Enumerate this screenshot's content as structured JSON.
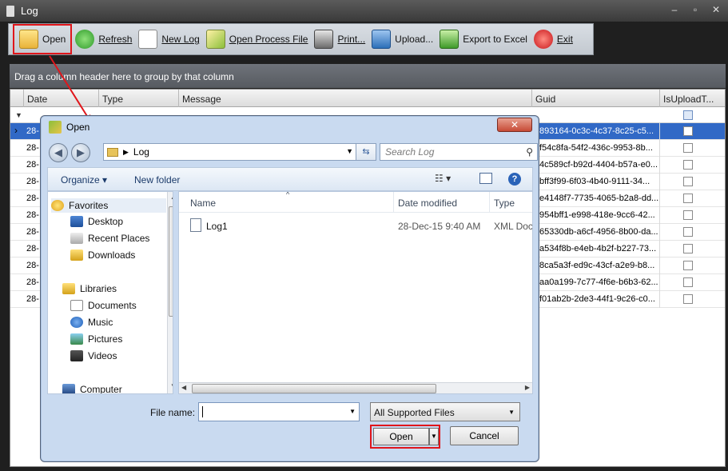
{
  "window": {
    "title": "Log",
    "minimize": "–",
    "maximize": "▫",
    "close": "✕"
  },
  "toolbar": {
    "items": [
      {
        "label": "Open"
      },
      {
        "label": "Refresh"
      },
      {
        "label": "New Log"
      },
      {
        "label": "Open Process File"
      },
      {
        "label": "Print..."
      },
      {
        "label": "Upload..."
      },
      {
        "label": "Export to Excel"
      },
      {
        "label": "Exit"
      }
    ]
  },
  "grid": {
    "group_hint": "Drag a column header here to group by that column",
    "columns": [
      "Date",
      "Type",
      "Message",
      "Guid",
      "IsUploadT..."
    ],
    "rows": [
      {
        "date": "28-",
        "guid": "893164-0c3c-4c37-8c25-c5..."
      },
      {
        "date": "28-",
        "guid": "f54c8fa-54f2-436c-9953-8b..."
      },
      {
        "date": "28-",
        "guid": "4c589cf-b92d-4404-b57a-e0..."
      },
      {
        "date": "28-",
        "guid": "bff3f99-6f03-4b40-9111-34..."
      },
      {
        "date": "28-",
        "guid": "e4148f7-7735-4065-b2a8-dd..."
      },
      {
        "date": "28-",
        "guid": "954bff1-e998-418e-9cc6-42..."
      },
      {
        "date": "28-",
        "guid": "65330db-a6cf-4956-8b00-da..."
      },
      {
        "date": "28-",
        "guid": "a534f8b-e4eb-4b2f-b227-73..."
      },
      {
        "date": "28-",
        "guid": "8ca5a3f-ed9c-43cf-a2e9-b8..."
      },
      {
        "date": "28-",
        "guid": "aa0a199-7c77-4f6e-b6b3-62..."
      },
      {
        "date": "28-",
        "guid": "f01ab2b-2de3-44f1-9c26-c0..."
      }
    ]
  },
  "dialog": {
    "title": "Open",
    "close": "✕",
    "back": "◀",
    "forward": "▶",
    "address_path": "Log",
    "search_placeholder": "Search Log",
    "organize": "Organize ▾",
    "new_folder": "New folder",
    "nav": {
      "favorites": "Favorites",
      "desktop": "Desktop",
      "recent_places": "Recent Places",
      "downloads": "Downloads",
      "libraries": "Libraries",
      "documents": "Documents",
      "music": "Music",
      "pictures": "Pictures",
      "videos": "Videos",
      "computer": "Computer"
    },
    "columns": {
      "name": "Name",
      "date_modified": "Date modified",
      "type": "Type"
    },
    "files": [
      {
        "name": "Log1",
        "date": "28-Dec-15 9:40 AM",
        "type": "XML Document"
      }
    ],
    "file_name_label": "File name:",
    "file_name_value": "",
    "file_type": "All Supported Files",
    "open_button": "Open",
    "cancel_button": "Cancel"
  },
  "colors": {
    "highlight": "#e0161b",
    "selection": "#3169c6"
  }
}
